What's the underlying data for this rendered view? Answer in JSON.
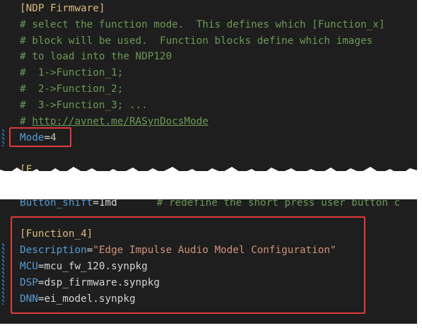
{
  "editor": {
    "top_block": {
      "section_header": "[NDP Firmware]",
      "comment_lines": [
        "# select the function mode.  This defines which [Function_x]",
        "# block will be used.  Function blocks define which images",
        "# to load into the NDP120",
        "#  1->Function_1;",
        "#  2->Function_2;",
        "#  3->Function_3; ..."
      ],
      "url_comment_prefix": "# ",
      "url_comment_link": "http://avnet.me/RASynDocsMode",
      "mode_key": "Mode",
      "mode_value": "4",
      "partial_header": "[F"
    },
    "torn_line": {
      "key": "Button_shift",
      "value": "=1md",
      "comment": "# redefine the short press user button c"
    },
    "function_block": {
      "header": "[Function_4]",
      "description_key": "Description",
      "description_value": "\"Edge Impulse Audio Model Configuration\"",
      "mcu_key": "MCU",
      "mcu_value": "mcu_fw_120.synpkg",
      "dsp_key": "DSP",
      "dsp_value": "dsp_firmware.synpkg",
      "dnn_key": "DNN",
      "dnn_value": "ei_model.synpkg"
    },
    "equals_sign": "=",
    "colors": {
      "background": "#1e1e1e",
      "section_header": "#d7ba7d",
      "comment": "#6a9955",
      "key": "#569cd6",
      "string": "#ce9178",
      "number": "#b5cea8",
      "highlight_box": "#e03a3a"
    }
  }
}
